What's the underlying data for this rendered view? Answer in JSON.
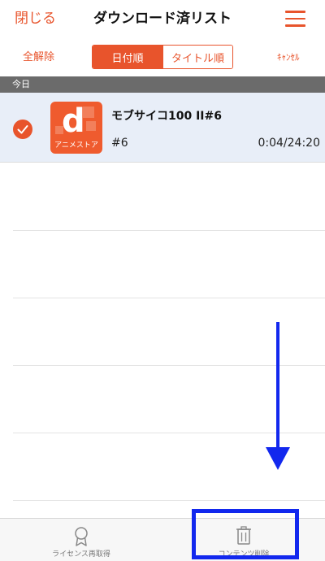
{
  "header": {
    "close_label": "閉じる",
    "title": "ダウンロード済リスト",
    "menu_icon": "hamburger-menu-icon"
  },
  "toolbar": {
    "clear_all_label": "全解除",
    "sort_options": [
      {
        "label": "日付順",
        "selected": true
      },
      {
        "label": "タイトル順",
        "selected": false
      }
    ],
    "cancel_label": "ｷｬﾝｾﾙ"
  },
  "sections": [
    {
      "header": "今日",
      "items": [
        {
          "selected": true,
          "thumbnail_letter": "d",
          "thumbnail_label": "アニメストア",
          "title": "モブサイコ100 II#6",
          "episode": "#6",
          "duration": "0:04/24:20"
        }
      ]
    }
  ],
  "bottom_bar": {
    "items": [
      {
        "label": "ライセンス再取得",
        "icon": "ribbon-award-icon"
      },
      {
        "label": "コンテンツ削除",
        "icon": "trash-icon"
      }
    ]
  },
  "annotations": {
    "arrow_color": "#1228ee",
    "arrow_direction": "down",
    "highlight_target": "delete-content-button"
  },
  "colors": {
    "accent": "#e8542c",
    "section_header_bg": "#6b6b6b",
    "selected_row_bg": "#e8eef8"
  }
}
